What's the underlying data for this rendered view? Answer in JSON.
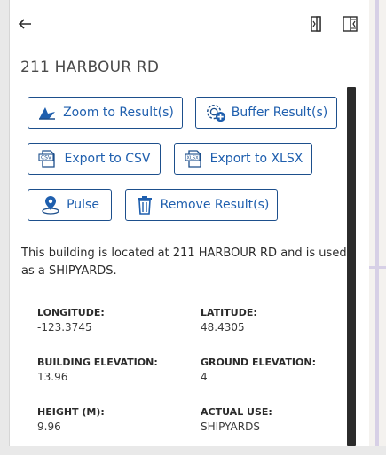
{
  "header": {
    "title": "211 HARBOUR RD"
  },
  "actions": {
    "zoom_label": "Zoom to Result(s)",
    "buffer_label": "Buffer Result(s)",
    "export_csv_label": "Export to CSV",
    "export_xlsx_label": "Export to XLSX",
    "pulse_label": "Pulse",
    "remove_label": "Remove Result(s)",
    "csv_badge": "CSV",
    "xlsx_badge": "XLSX"
  },
  "description": "This building is located at 211 HARBOUR RD and is used as a SHIPYARDS.",
  "fields": [
    {
      "label": "LONGITUDE:",
      "value": "-123.3745"
    },
    {
      "label": "LATITUDE:",
      "value": "48.4305"
    },
    {
      "label": "BUILDING ELEVATION:",
      "value": "13.96"
    },
    {
      "label": "GROUND ELEVATION:",
      "value": "4"
    },
    {
      "label": "HEIGHT (M):",
      "value": "9.96"
    },
    {
      "label": "ACTUAL USE:",
      "value": "SHIPYARDS"
    }
  ],
  "colors": {
    "accent": "#1f5fae",
    "border": "#1d4f8c",
    "scrollbar": "#2b2b2b"
  }
}
